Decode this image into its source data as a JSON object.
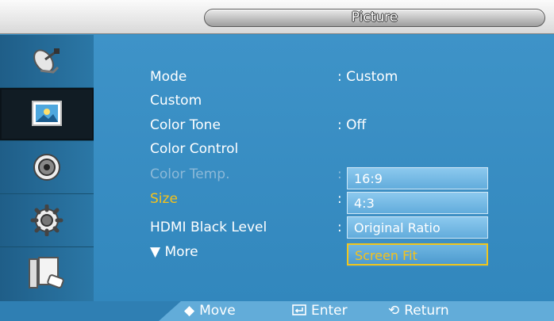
{
  "header": {
    "title": "Picture"
  },
  "sidebar": {
    "items": [
      {
        "icon": "satellite-dish-icon"
      },
      {
        "icon": "picture-icon",
        "active": true
      },
      {
        "icon": "speaker-icon"
      },
      {
        "icon": "gear-icon"
      },
      {
        "icon": "display-remote-icon"
      }
    ]
  },
  "menu": {
    "rows": [
      {
        "label": "Mode",
        "value": ": Custom"
      },
      {
        "label": "Custom",
        "value": ""
      },
      {
        "label": "Color Tone",
        "value": ": Off"
      },
      {
        "label": "Color Control",
        "value": ""
      },
      {
        "label": "Color Temp.",
        "value": ":",
        "disabled": true
      },
      {
        "label": "Size",
        "value": ":",
        "selected": true
      },
      {
        "label": "HDMI Black Level",
        "value": ":"
      },
      {
        "label": "▼ More",
        "value": ""
      }
    ]
  },
  "dropdown": {
    "options": [
      "16:9",
      "4:3",
      "Original Ratio",
      "Screen Fit"
    ],
    "highlighted": "Screen Fit"
  },
  "footer": {
    "move": "Move",
    "enter": "Enter",
    "return": "Return"
  },
  "colors": {
    "panel": "#3a8ec1",
    "selected_text": "#f6c21a",
    "dim_text": "#8cb9d8"
  }
}
